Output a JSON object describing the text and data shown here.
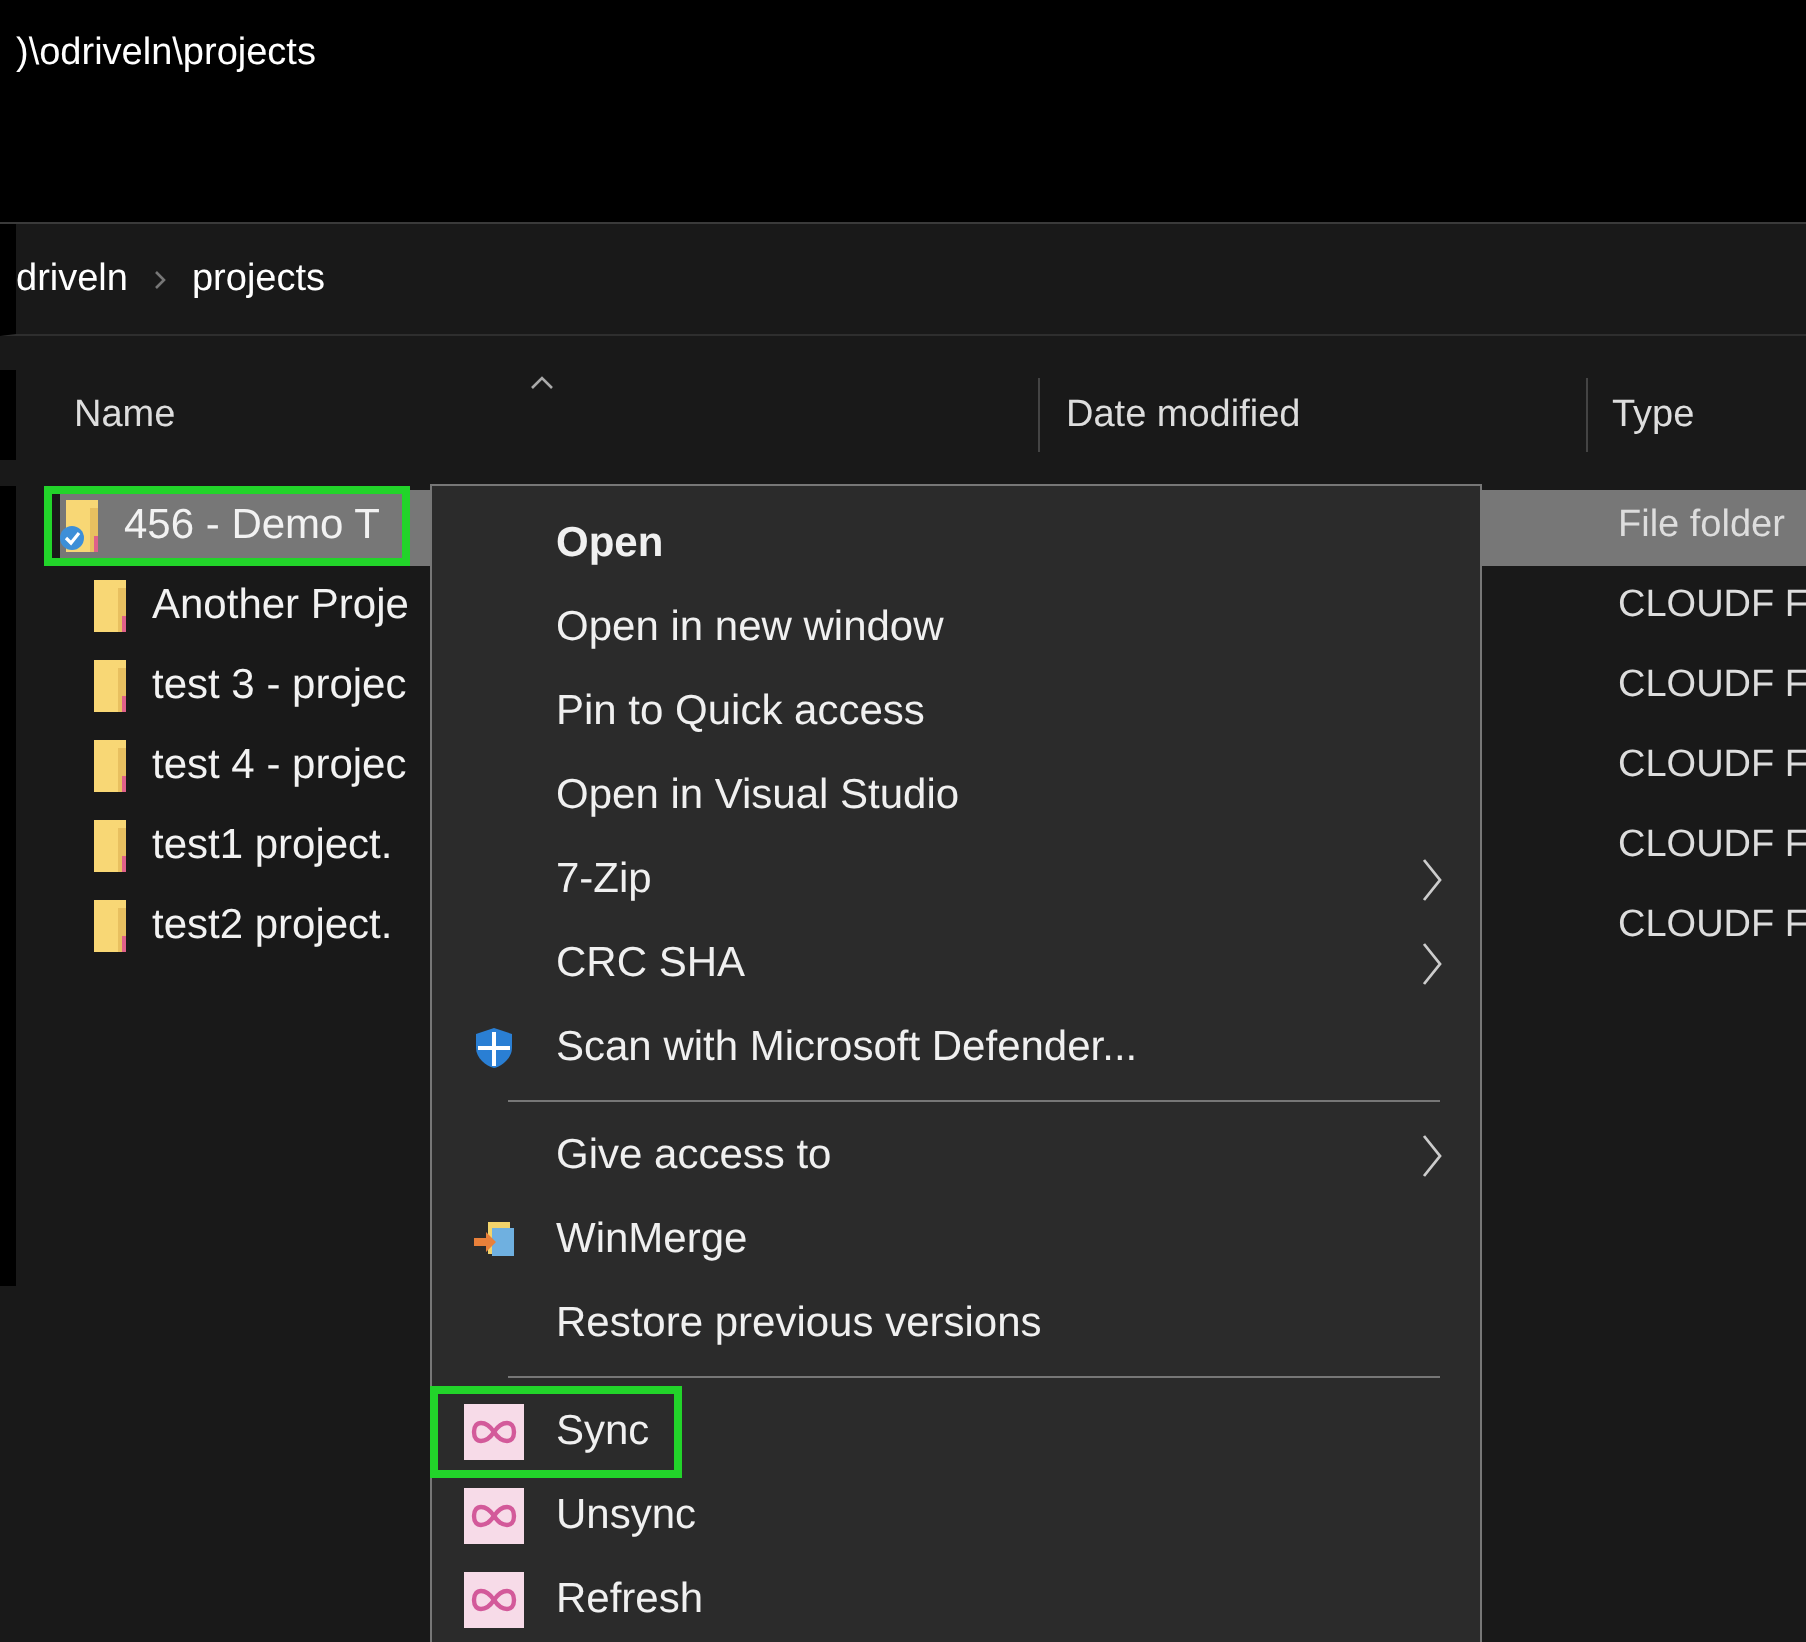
{
  "address_bar": {
    "path": ")\\odriveln\\projects"
  },
  "breadcrumb": [
    {
      "label": "driveln"
    },
    {
      "label": "projects"
    }
  ],
  "columns": [
    {
      "label": "Name",
      "sorted": true
    },
    {
      "label": "Date modified",
      "sorted": false
    },
    {
      "label": "Type",
      "sorted": false
    }
  ],
  "rows": [
    {
      "name": "456 - Demo T",
      "type": "File folder",
      "selected": true,
      "synced": true,
      "highlighted": true
    },
    {
      "name": "Another Proje",
      "type": "CLOUDF F",
      "selected": false,
      "synced": false,
      "highlighted": false
    },
    {
      "name": "test 3 - projec",
      "type": "CLOUDF F",
      "selected": false,
      "synced": false,
      "highlighted": false
    },
    {
      "name": "test 4 - projec",
      "type": "CLOUDF F",
      "selected": false,
      "synced": false,
      "highlighted": false
    },
    {
      "name": "test1 project.",
      "type": "CLOUDF F",
      "selected": false,
      "synced": false,
      "highlighted": false
    },
    {
      "name": "test2 project.",
      "type": "CLOUDF F",
      "selected": false,
      "synced": false,
      "highlighted": false
    }
  ],
  "context_menu": [
    {
      "kind": "plain",
      "label": "Open",
      "bold": true,
      "submenu": false,
      "highlighted": false
    },
    {
      "kind": "plain",
      "label": "Open in new window",
      "bold": false,
      "submenu": false,
      "highlighted": false
    },
    {
      "kind": "plain",
      "label": "Pin to Quick access",
      "bold": false,
      "submenu": false,
      "highlighted": false
    },
    {
      "kind": "plain",
      "label": "Open in Visual Studio",
      "bold": false,
      "submenu": false,
      "highlighted": false
    },
    {
      "kind": "plain",
      "label": "7-Zip",
      "bold": false,
      "submenu": true,
      "highlighted": false
    },
    {
      "kind": "plain",
      "label": "CRC SHA",
      "bold": false,
      "submenu": true,
      "highlighted": false
    },
    {
      "kind": "defender",
      "label": "Scan with Microsoft Defender...",
      "bold": false,
      "submenu": false,
      "highlighted": false
    },
    {
      "kind": "separator"
    },
    {
      "kind": "plain",
      "label": "Give access to",
      "bold": false,
      "submenu": true,
      "highlighted": false
    },
    {
      "kind": "winmerge",
      "label": "WinMerge",
      "bold": false,
      "submenu": false,
      "highlighted": false
    },
    {
      "kind": "plain",
      "label": "Restore previous versions",
      "bold": false,
      "submenu": false,
      "highlighted": false
    },
    {
      "kind": "separator"
    },
    {
      "kind": "sync",
      "label": "Sync",
      "bold": false,
      "submenu": false,
      "highlighted": true
    },
    {
      "kind": "sync",
      "label": "Unsync",
      "bold": false,
      "submenu": false,
      "highlighted": false
    },
    {
      "kind": "sync",
      "label": "Refresh",
      "bold": false,
      "submenu": false,
      "highlighted": false
    }
  ]
}
